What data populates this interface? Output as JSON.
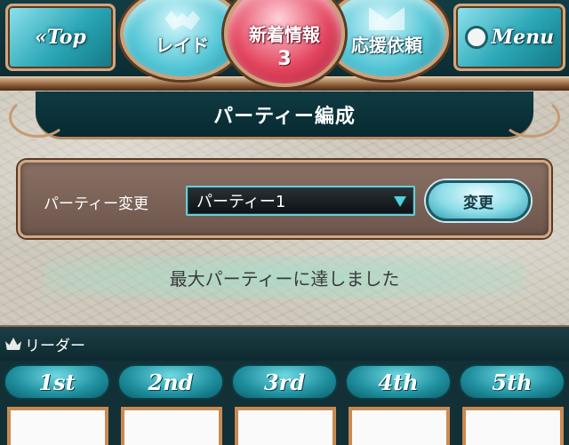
{
  "nav": {
    "top_label": "Top",
    "raid_label": "レイド",
    "news_label": "新着情報",
    "news_count": "3",
    "help_label": "応援依頼",
    "menu_label": "Menu"
  },
  "title": "パーティー編成",
  "party": {
    "label": "パーティー変更",
    "selected": "パーティー1",
    "change_button": "変更"
  },
  "notice": "最大パーティーに達しました",
  "leader": {
    "label": "リーダー",
    "slots": [
      "1st",
      "2nd",
      "3rd",
      "4th",
      "5th"
    ]
  },
  "colors": {
    "nav_teal": "#2aa6b6",
    "news_red": "#e4465f",
    "frame_bronze": "#c98a52"
  }
}
